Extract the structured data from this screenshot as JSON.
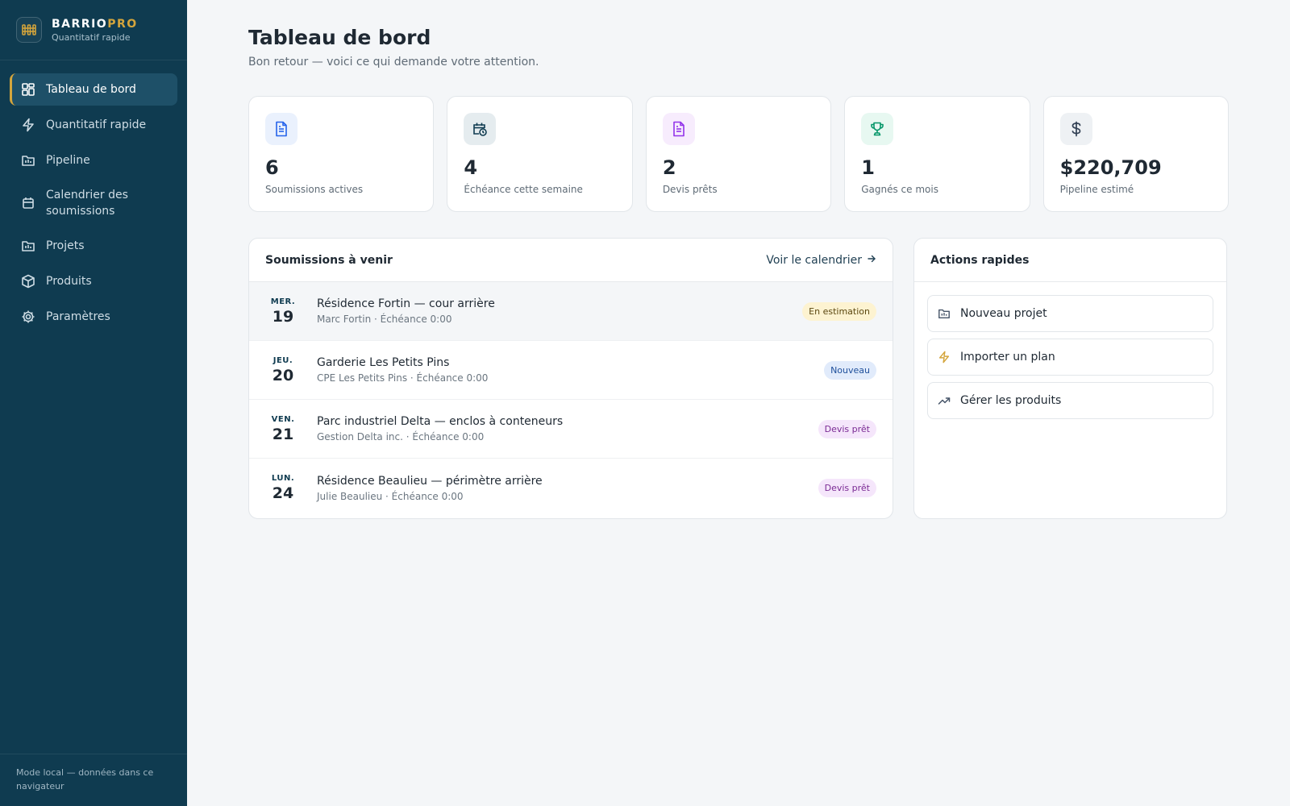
{
  "brand": {
    "name_main": "BARRIO",
    "name_accent": "PRO",
    "tagline": "Quantitatif rapide"
  },
  "sidebar": {
    "items": [
      {
        "label": "Tableau de bord",
        "icon": "dashboard-icon",
        "active": true
      },
      {
        "label": "Quantitatif rapide",
        "icon": "bolt-icon"
      },
      {
        "label": "Pipeline",
        "icon": "folder-icon"
      },
      {
        "label": "Calendrier des soumissions",
        "icon": "calendar-icon"
      },
      {
        "label": "Projets",
        "icon": "folder-icon"
      },
      {
        "label": "Produits",
        "icon": "box-icon"
      },
      {
        "label": "Paramètres",
        "icon": "gear-icon"
      }
    ],
    "footer": "Mode local — données dans ce navigateur"
  },
  "header": {
    "title": "Tableau de bord",
    "subtitle": "Bon retour — voici ce qui demande votre attention."
  },
  "stats": [
    {
      "value": "6",
      "label": "Soumissions actives",
      "icon": "document-icon",
      "color": "#2563eb",
      "bg": "#eaf1fd"
    },
    {
      "value": "4",
      "label": "Échéance cette semaine",
      "icon": "calendar-clock-icon",
      "color": "#0f3b50",
      "bg": "#e5ecef"
    },
    {
      "value": "2",
      "label": "Devis prêts",
      "icon": "document-icon",
      "color": "#9333ea",
      "bg": "#f7ecfd"
    },
    {
      "value": "1",
      "label": "Gagnés ce mois",
      "icon": "trophy-icon",
      "color": "#059669",
      "bg": "#e7f8f1"
    },
    {
      "value": "$220,709",
      "label": "Pipeline estimé",
      "icon": "dollar-icon",
      "color": "#334155",
      "bg": "#eef1f4"
    }
  ],
  "upcoming": {
    "title": "Soumissions à venir",
    "link": "Voir le calendrier",
    "rows": [
      {
        "dow": "MER.",
        "day": "19",
        "title": "Résidence Fortin — cour arrière",
        "meta": "Marc Fortin · Échéance 0:00",
        "badge": "En estimation",
        "badge_bg": "#fdf3d1",
        "badge_fg": "#5b4710"
      },
      {
        "dow": "JEU.",
        "day": "20",
        "title": "Garderie Les Petits Pins",
        "meta": "CPE Les Petits Pins · Échéance 0:00",
        "badge": "Nouveau",
        "badge_bg": "#e1ebfb",
        "badge_fg": "#1e4f9b"
      },
      {
        "dow": "VEN.",
        "day": "21",
        "title": "Parc industriel Delta — enclos à conteneurs",
        "meta": "Gestion Delta inc. · Échéance 0:00",
        "badge": "Devis prêt",
        "badge_bg": "#f5e6fb",
        "badge_fg": "#7a2a94"
      },
      {
        "dow": "LUN.",
        "day": "24",
        "title": "Résidence Beaulieu — périmètre arrière",
        "meta": "Julie Beaulieu · Échéance 0:00",
        "badge": "Devis prêt",
        "badge_bg": "#f5e6fb",
        "badge_fg": "#7a2a94"
      }
    ]
  },
  "quick_actions": {
    "title": "Actions rapides",
    "items": [
      {
        "label": "Nouveau projet",
        "icon": "folder-icon",
        "color": "#475569"
      },
      {
        "label": "Importer un plan",
        "icon": "bolt-icon",
        "color": "#d4a53c"
      },
      {
        "label": "Gérer les produits",
        "icon": "trending-up-icon",
        "color": "#475569"
      }
    ]
  },
  "colors": {
    "sidebar": "#0f3b50",
    "accent": "#d4a53c",
    "background": "#f4f6f8"
  }
}
